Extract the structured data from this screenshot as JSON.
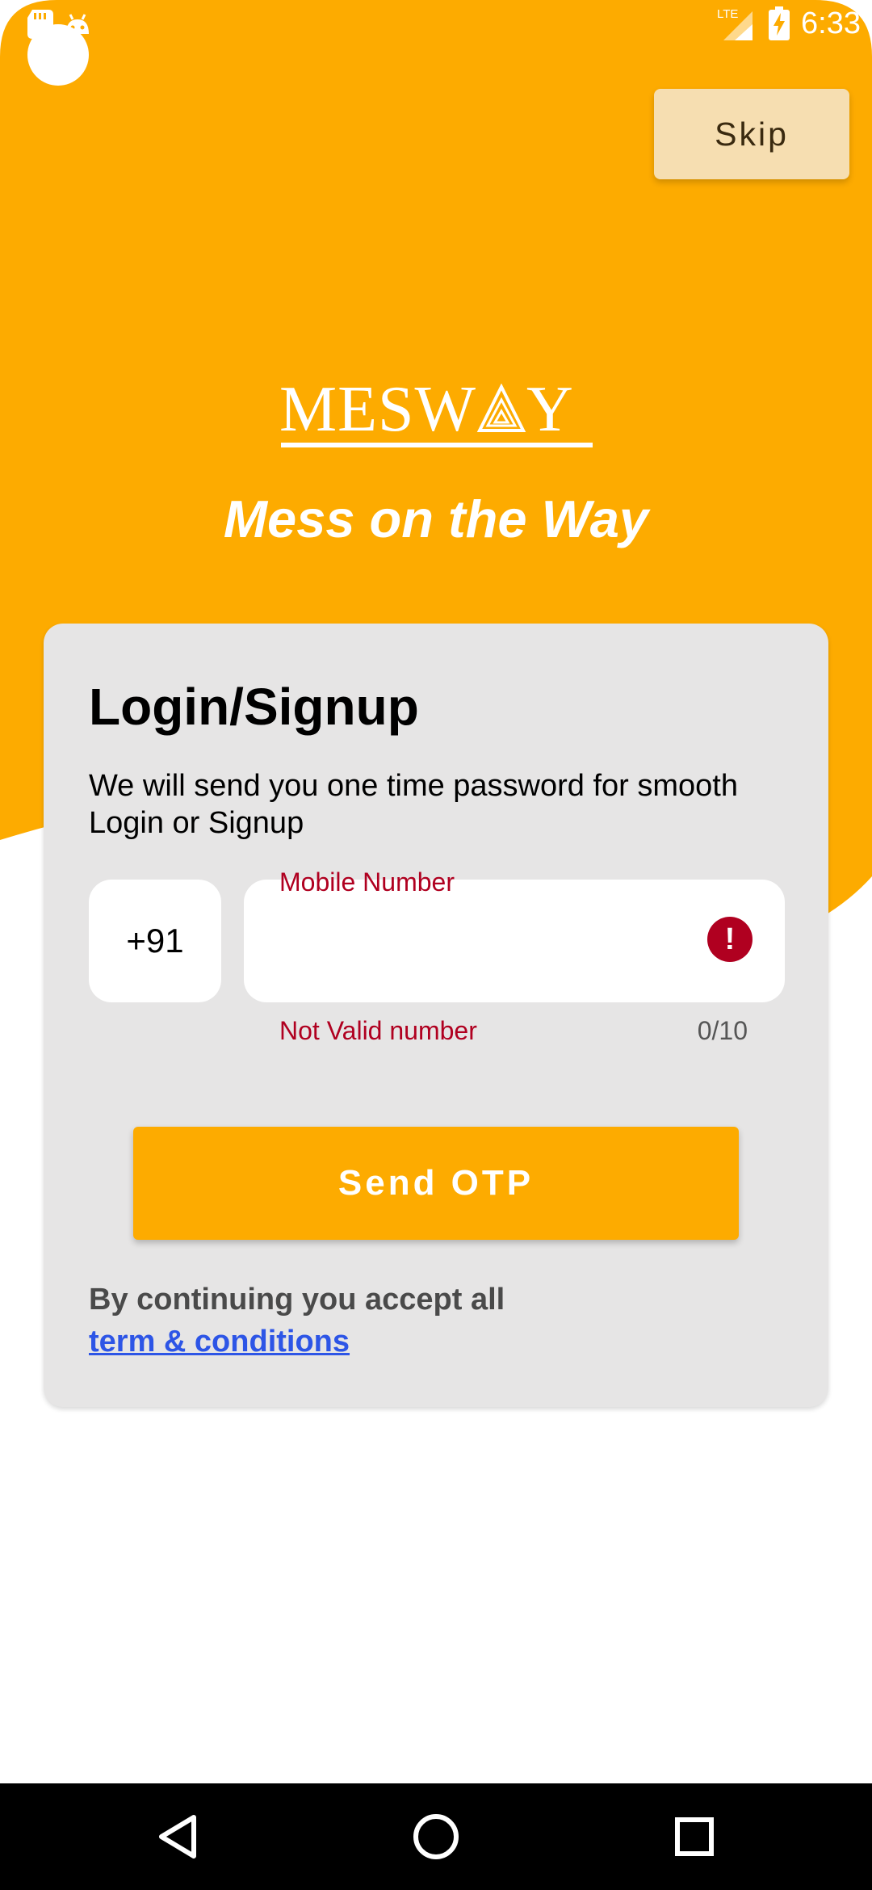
{
  "status_bar": {
    "time": "6:33",
    "network": "LTE",
    "icons": [
      "sd-card-icon",
      "android-icon",
      "signal-icon",
      "battery-charging-icon"
    ]
  },
  "header": {
    "skip_label": "Skip",
    "logo_text": "MESWAY",
    "tagline": "Mess on the Way"
  },
  "login": {
    "title": "Login/Signup",
    "description": "We will send you one time password for smooth Login or Signup",
    "country_code": "+91",
    "phone_label": "Mobile Number",
    "phone_value": "",
    "error_message": "Not Valid number",
    "char_counter": "0/10",
    "send_button_label": "Send OTP",
    "terms_prefix": "By continuing you accept all",
    "terms_link": "term & conditions "
  },
  "nav_bar": {
    "buttons": [
      "back-icon",
      "home-icon",
      "recents-icon"
    ]
  },
  "colors": {
    "accent": "#fdab00",
    "skip_bg": "#f6deb1",
    "card_bg": "#e6e5e5",
    "error": "#b00020",
    "link": "#2d55e6"
  }
}
